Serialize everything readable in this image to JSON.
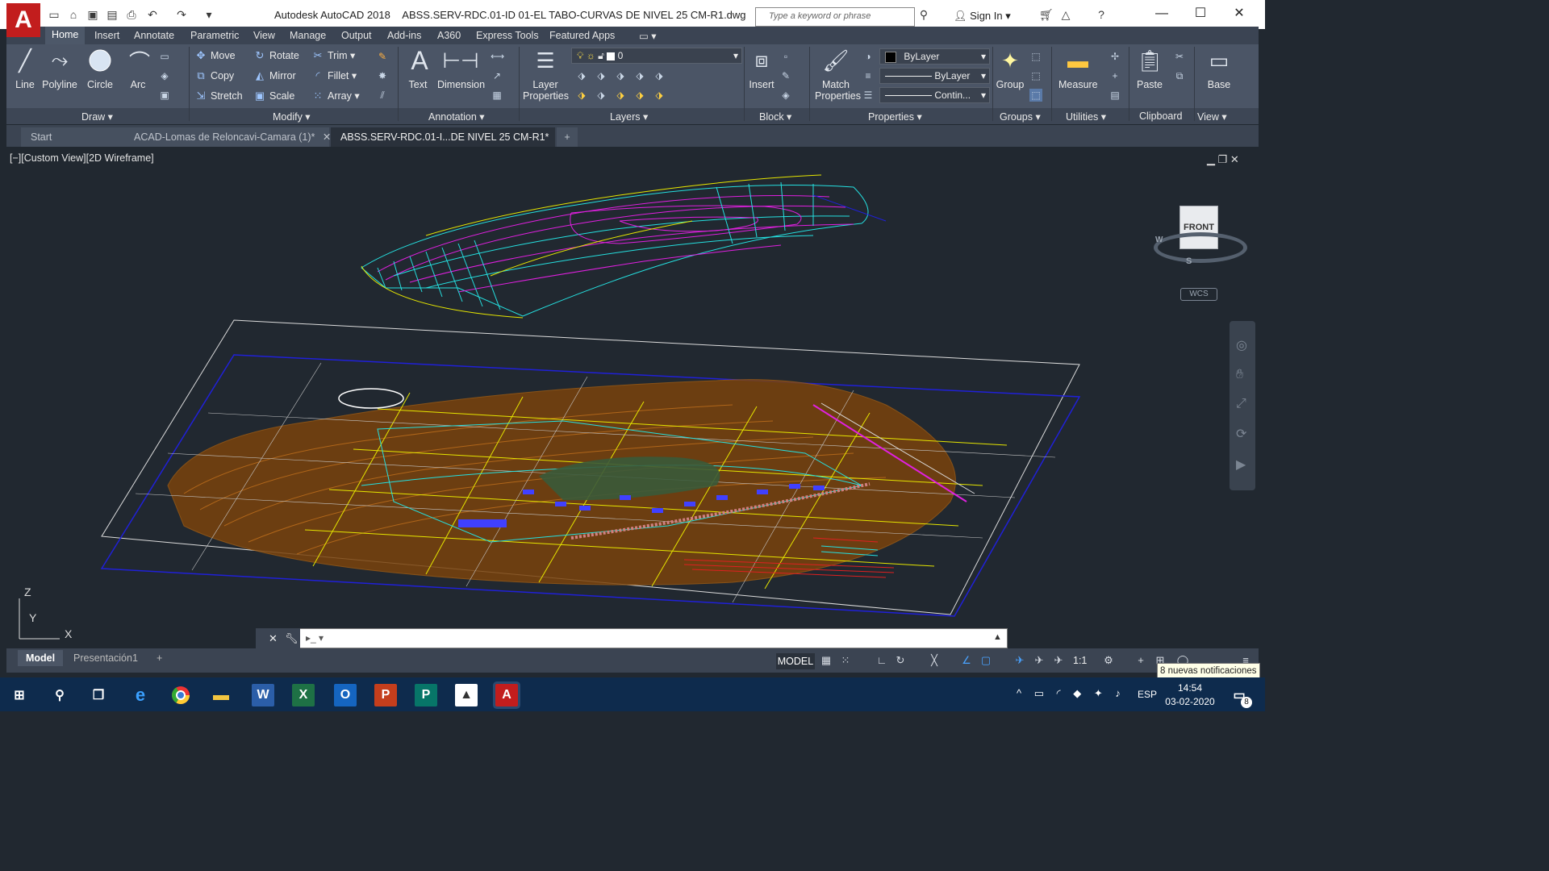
{
  "titlebar": {
    "app_name": "Autodesk AutoCAD 2018",
    "file_name": "ABSS.SERV-RDC.01-ID 01-EL TABO-CURVAS DE NIVEL 25 CM-R1.dwg",
    "search_placeholder": "Type a keyword or phrase",
    "signin_label": "Sign In",
    "logo_letter": "A"
  },
  "ribbon_tabs": [
    "Home",
    "Insert",
    "Annotate",
    "Parametric",
    "View",
    "Manage",
    "Output",
    "Add-ins",
    "A360",
    "Express Tools",
    "Featured Apps"
  ],
  "panels": {
    "draw": {
      "label": "Draw",
      "line": "Line",
      "polyline": "Polyline",
      "circle": "Circle",
      "arc": "Arc"
    },
    "modify": {
      "label": "Modify",
      "move": "Move",
      "rotate": "Rotate",
      "trim": "Trim",
      "copy": "Copy",
      "mirror": "Mirror",
      "fillet": "Fillet",
      "stretch": "Stretch",
      "scale": "Scale",
      "array": "Array"
    },
    "annotation": {
      "label": "Annotation",
      "text": "Text",
      "dimension": "Dimension"
    },
    "layers": {
      "label": "Layers",
      "layer_properties_1": "Layer",
      "layer_properties_2": "Properties",
      "current_layer": "0"
    },
    "block": {
      "label": "Block",
      "insert": "Insert"
    },
    "properties": {
      "label": "Properties",
      "match_1": "Match",
      "match_2": "Properties",
      "color": "ByLayer",
      "lineweight": "ByLayer",
      "linetype": "Contin..."
    },
    "groups": {
      "label": "Groups",
      "group": "Group"
    },
    "utilities": {
      "label": "Utilities",
      "measure": "Measure"
    },
    "clipboard": {
      "label": "Clipboard",
      "paste": "Paste"
    },
    "view": {
      "label": "View",
      "base": "Base"
    }
  },
  "doc_tabs": [
    {
      "label": "Start"
    },
    {
      "label": "ACAD-Lomas de Reloncavi-Camara (1)*"
    },
    {
      "label": "ABSS.SERV-RDC.01-I...DE NIVEL 25 CM-R1*"
    }
  ],
  "viewport": {
    "label": "[−][Custom View][2D Wireframe]",
    "viewcube_face": "FRONT",
    "compass_w": "W",
    "compass_s": "S",
    "wcs": "WCS",
    "ucs_z": "Z",
    "ucs_y": "Y",
    "ucs_x": "X"
  },
  "layout_tabs": [
    "Model",
    "Presentación1"
  ],
  "status": {
    "model": "MODEL",
    "scale": "1:1",
    "notification": "8 nuevas notificaciones"
  },
  "taskbar": {
    "time": "14:54",
    "date": "03-02-2020",
    "language": "ESP",
    "notification_count": "8"
  },
  "colors": {
    "viewport_bg": "#212830",
    "ribbon_bg": "#4b5566",
    "taskbar_bg": "#0e2b4d",
    "terrain_brown": "#9a5a14",
    "contour_cyan": "#25e0e0",
    "contour_magenta": "#e020e0",
    "grid_yellow": "#e6e600",
    "frame_blue": "#2020d8"
  }
}
